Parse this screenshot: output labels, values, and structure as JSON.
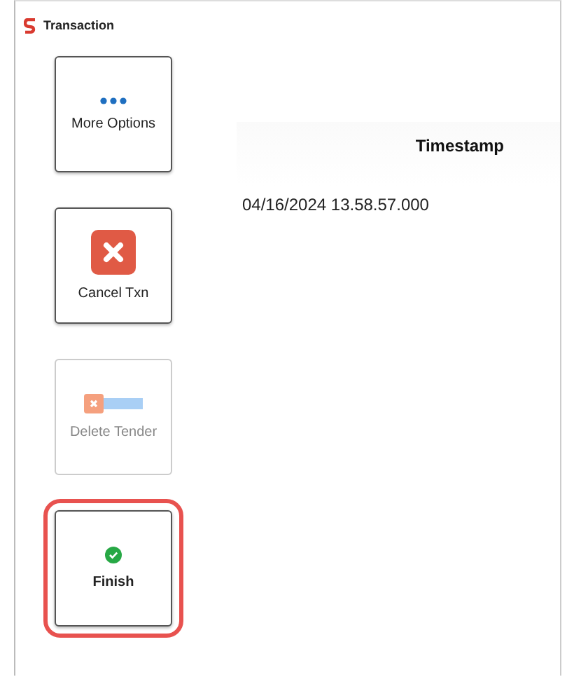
{
  "window": {
    "title": "Transaction"
  },
  "buttons": [
    {
      "label": "More Options",
      "kind": "dots",
      "disabled": false,
      "highlighted": false
    },
    {
      "label": "Cancel Txn",
      "kind": "cancel",
      "disabled": false,
      "highlighted": false
    },
    {
      "label": "Delete Tender",
      "kind": "delete",
      "disabled": true,
      "highlighted": false
    },
    {
      "label": "Finish",
      "kind": "check",
      "disabled": false,
      "highlighted": true
    }
  ],
  "table": {
    "columns": [
      "Timestamp"
    ],
    "rows": [
      [
        "04/16/2024 13.58.57.000"
      ]
    ]
  }
}
